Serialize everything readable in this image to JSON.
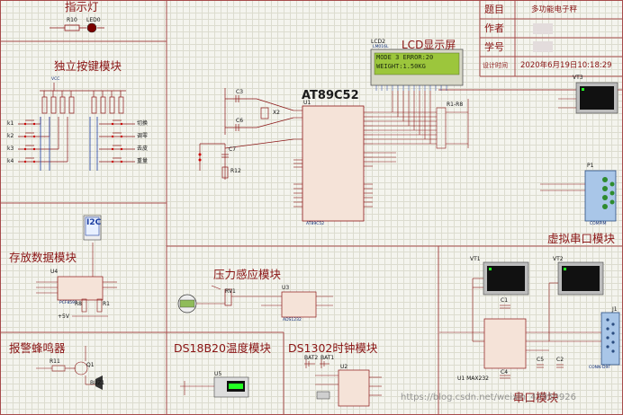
{
  "modules": {
    "indicator": "指示灯",
    "keys": "独立按键模块",
    "lcd": "LCD显示屏",
    "storage": "存放数据模块",
    "pressure": "压力感应模块",
    "alarm": "报警蜂鸣器",
    "ds18b20": "DS18B20温度模块",
    "ds1302": "DS1302时钟模块",
    "serial": "虚拟串口模块",
    "usart": "串口模块"
  },
  "title_block": {
    "topic_label": "题目",
    "topic_value": "多功能电子秤",
    "author_label": "作者",
    "id_label": "学号",
    "time_label": "设计时间",
    "time_value": "2020年6月19日10:18:29"
  },
  "mcu": {
    "label": "AT89C52",
    "ref": "U1",
    "sub": "AT89C52"
  },
  "lcd_panel": {
    "ref": "LCD2",
    "part": "LM016L",
    "line1": "MODE 3  ERROR:20",
    "line2": "WEIGHT:1.50KG"
  },
  "i2c_badge": "I2C",
  "components": {
    "r10": "R10",
    "led0": "LED0",
    "c3": "C3",
    "c6": "C6",
    "c7": "C7",
    "x2": "X2",
    "r12": "R12",
    "rn": "R1-R8",
    "u4": "U4",
    "u4_part": "PCF8591",
    "r8": "R8",
    "r1": "R1",
    "rv1": "RV1",
    "u3": "U3",
    "u3_part": "ADS1232",
    "r11": "R11",
    "q1": "Q1",
    "buz1": "BUZ1",
    "u5": "U5",
    "bat2": "BAT2",
    "bat1": "BAT1",
    "u2": "U2",
    "vt1": "VT1",
    "vt2": "VT2",
    "vt3": "VT3",
    "p1": "P1",
    "j1": "J1",
    "c1": "C1",
    "c2": "C2",
    "c4": "C4",
    "c5": "C5",
    "u1max": "U1  MAX232",
    "vcc": "VCC",
    "p5v": "+5V",
    "compim": "COMPIM",
    "conn": "CONN-D9F"
  },
  "keys": [
    "k1",
    "k2",
    "k3",
    "k4"
  ],
  "key_right": [
    "切换",
    "调零",
    "去皮",
    "重量"
  ],
  "watermark": "https://blog.csdn.net/weixin_43950926"
}
